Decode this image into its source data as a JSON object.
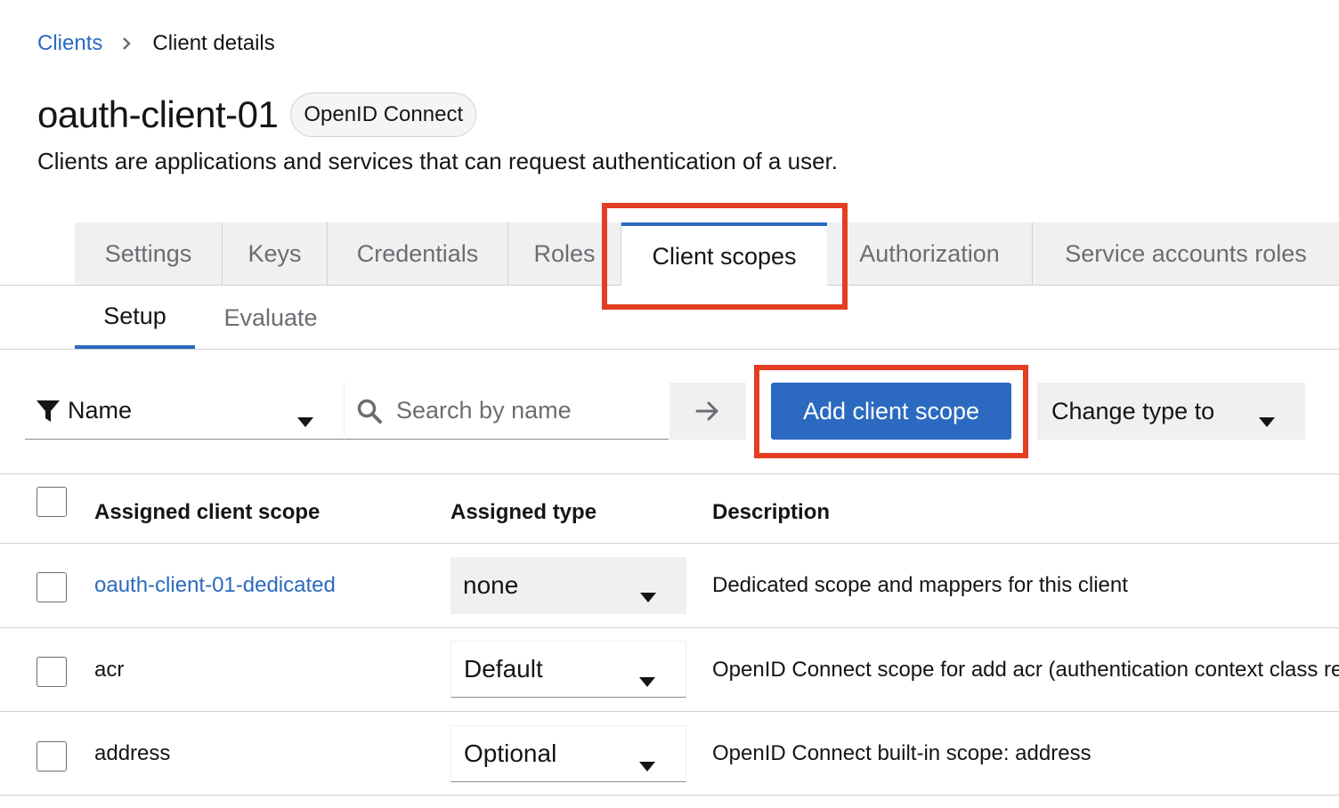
{
  "breadcrumb": {
    "parent": "Clients",
    "current": "Client details"
  },
  "header": {
    "title": "oauth-client-01",
    "badge": "OpenID Connect",
    "subtitle": "Clients are applications and services that can request authentication of a user."
  },
  "tabs": [
    {
      "label": "Settings",
      "active": false
    },
    {
      "label": "Keys",
      "active": false
    },
    {
      "label": "Credentials",
      "active": false
    },
    {
      "label": "Roles",
      "active": false
    },
    {
      "label": "Client scopes",
      "active": true
    },
    {
      "label": "Authorization",
      "active": false
    },
    {
      "label": "Service accounts roles",
      "active": false
    }
  ],
  "subtabs": [
    {
      "label": "Setup",
      "active": true
    },
    {
      "label": "Evaluate",
      "active": false
    }
  ],
  "toolbar": {
    "filter_label": "Name",
    "search_placeholder": "Search by name",
    "add_button": "Add client scope",
    "change_type": "Change type to"
  },
  "table": {
    "headers": [
      "Assigned client scope",
      "Assigned type",
      "Description"
    ],
    "rows": [
      {
        "name": "oauth-client-01-dedicated",
        "type": "none",
        "description": "Dedicated scope and mappers for this client"
      },
      {
        "name": "acr",
        "type": "Default",
        "description": "OpenID Connect scope for add acr (authentication context class reference) to the token"
      },
      {
        "name": "address",
        "type": "Optional",
        "description": "OpenID Connect built-in scope: address"
      }
    ]
  },
  "colors": {
    "accent": "#2b6ac0",
    "highlight": "#e33d22"
  }
}
